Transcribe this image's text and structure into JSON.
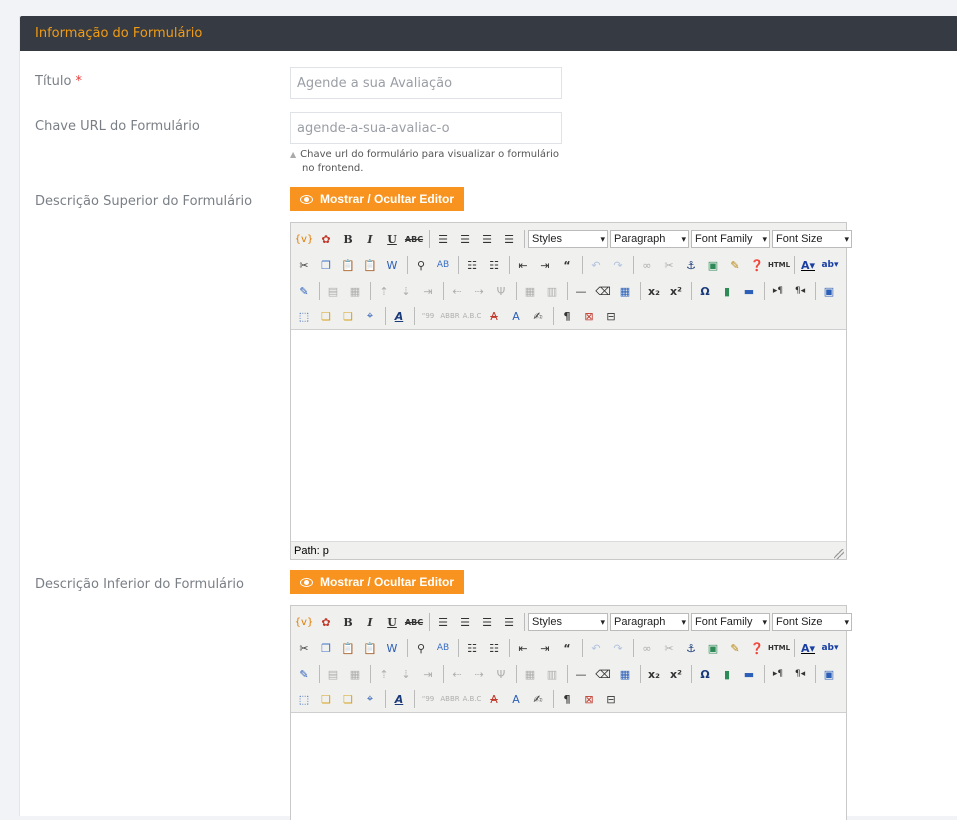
{
  "panel": {
    "title": "Informação do Formulário"
  },
  "fields": {
    "titulo": {
      "label": "Título",
      "required_mark": "*",
      "value": "Agende a sua Avaliação"
    },
    "chave": {
      "label": "Chave URL do Formulário",
      "value": "agende-a-sua-avaliac-o",
      "help_line1": "Chave url do formulário para visualizar o formulário",
      "help_line2": "no frontend."
    },
    "desc_sup": {
      "label": "Descrição Superior do Formulário"
    },
    "desc_inf": {
      "label": "Descrição Inferior do Formulário"
    }
  },
  "toggle_button_label": "Mostrar / Ocultar Editor",
  "editor": {
    "styles": "Styles",
    "format": "Paragraph",
    "font_family": "Font Family",
    "font_size": "Font Size",
    "path": "Path: p"
  },
  "icons": {
    "row1": [
      "template-icon",
      "cleanup-icon",
      "bold-icon",
      "italic-icon",
      "underline-icon",
      "strikethrough-icon",
      "align-left-icon",
      "align-center-icon",
      "align-right-icon",
      "align-justify-icon"
    ],
    "row2": [
      "cut-icon",
      "copy-icon",
      "paste-icon",
      "paste-text-icon",
      "paste-word-icon",
      "search-icon",
      "replace-icon",
      "bullet-list-icon",
      "numbered-list-icon",
      "outdent-icon",
      "indent-icon",
      "blockquote-icon",
      "undo-icon",
      "redo-icon",
      "link-icon",
      "unlink-icon",
      "anchor-icon",
      "image-icon",
      "cleanup-brush-icon",
      "help-icon",
      "html-icon",
      "forecolor-icon",
      "backcolor-icon"
    ],
    "row3": [
      "insert-time-icon",
      "table-icon",
      "row-props-icon",
      "cell-props-icon",
      "insert-row-before-icon",
      "insert-row-after-icon",
      "delete-row-icon",
      "insert-col-before-icon",
      "insert-col-after-icon",
      "delete-col-icon",
      "split-cells-icon",
      "merge-cells-icon",
      "horizontal-rule-icon",
      "remove-format-icon",
      "visual-aid-icon",
      "subscript-icon",
      "superscript-icon",
      "charmap-icon",
      "media-icon",
      "advanced-hr-icon",
      "ltr-icon",
      "rtl-icon",
      "fullscreen-icon"
    ],
    "row4": [
      "insert-layer-icon",
      "move-forward-icon",
      "move-backward-icon",
      "absolute-icon",
      "styleprops-icon",
      "cite-icon",
      "abbr-icon",
      "acronym-icon",
      "del-icon",
      "ins-icon",
      "attribs-icon",
      "visualchars-icon",
      "nonbreaking-icon",
      "pagebreak-icon"
    ]
  },
  "colors": {
    "accent": "#f7931e",
    "header_bg": "#363a43",
    "title_color": "#f39c12",
    "required": "#e53935"
  }
}
